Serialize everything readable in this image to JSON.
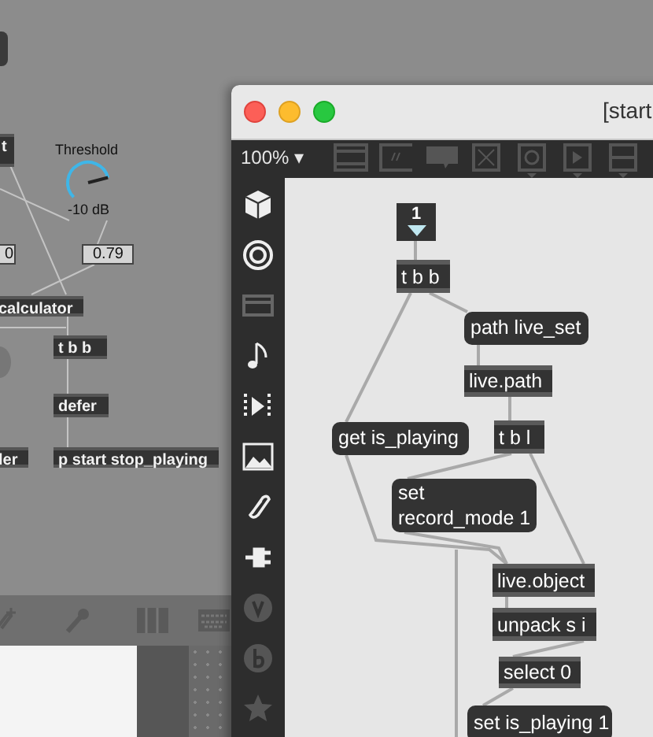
{
  "back_patcher": {
    "objects": [
      {
        "kind": "object",
        "text": "t"
      },
      {
        "kind": "number",
        "text": "0"
      },
      {
        "kind": "number",
        "text": "0.79"
      },
      {
        "kind": "object",
        "text": "calculator"
      },
      {
        "kind": "object",
        "text": "t b b"
      },
      {
        "kind": "object",
        "text": "defer"
      },
      {
        "kind": "object",
        "text": "ler"
      },
      {
        "kind": "object",
        "text": "p start stop_playing"
      }
    ],
    "dial": {
      "label": "Threshold",
      "reading": "-10 dB",
      "level": 0.78
    }
  },
  "window": {
    "title": "[start",
    "zoom": "100%",
    "zoom_caret": "▾",
    "objects": [
      {
        "kind": "number",
        "text": "1"
      },
      {
        "kind": "object",
        "text": "t b b"
      },
      {
        "kind": "message",
        "text": "path live_set"
      },
      {
        "kind": "object",
        "text": "live.path"
      },
      {
        "kind": "object",
        "text": "t b l"
      },
      {
        "kind": "message",
        "text": "get is_playing"
      },
      {
        "kind": "message",
        "text": "set\nrecord_mode 1"
      },
      {
        "kind": "object",
        "text": "live.object"
      },
      {
        "kind": "object",
        "text": "unpack s i"
      },
      {
        "kind": "object",
        "text": "select 0"
      },
      {
        "kind": "message",
        "text": "set is_playing 1"
      }
    ]
  }
}
